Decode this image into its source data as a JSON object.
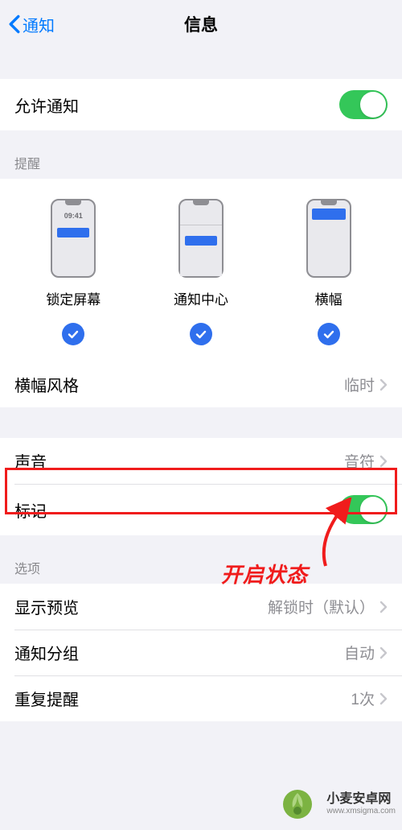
{
  "nav": {
    "back": "通知",
    "title": "信息"
  },
  "allow_notifications": {
    "label": "允许通知",
    "on": true
  },
  "alerts_header": "提醒",
  "alerts": {
    "lock": {
      "label": "锁定屏幕",
      "time": "09:41",
      "checked": true
    },
    "center": {
      "label": "通知中心",
      "checked": true
    },
    "banner": {
      "label": "横幅",
      "checked": true
    }
  },
  "banner_style": {
    "label": "横幅风格",
    "value": "临时"
  },
  "sound": {
    "label": "声音",
    "value": "音符"
  },
  "badges": {
    "label": "标记",
    "on": true
  },
  "options_header": "选项",
  "show_previews": {
    "label": "显示预览",
    "value": "解锁时（默认）"
  },
  "grouping": {
    "label": "通知分组",
    "value": "自动"
  },
  "repeat": {
    "label": "重复提醒",
    "value": "1次"
  },
  "annotation": {
    "label": "开启状态"
  },
  "watermark": {
    "name": "小麦安卓网",
    "url": "www.xmsigma.com"
  }
}
